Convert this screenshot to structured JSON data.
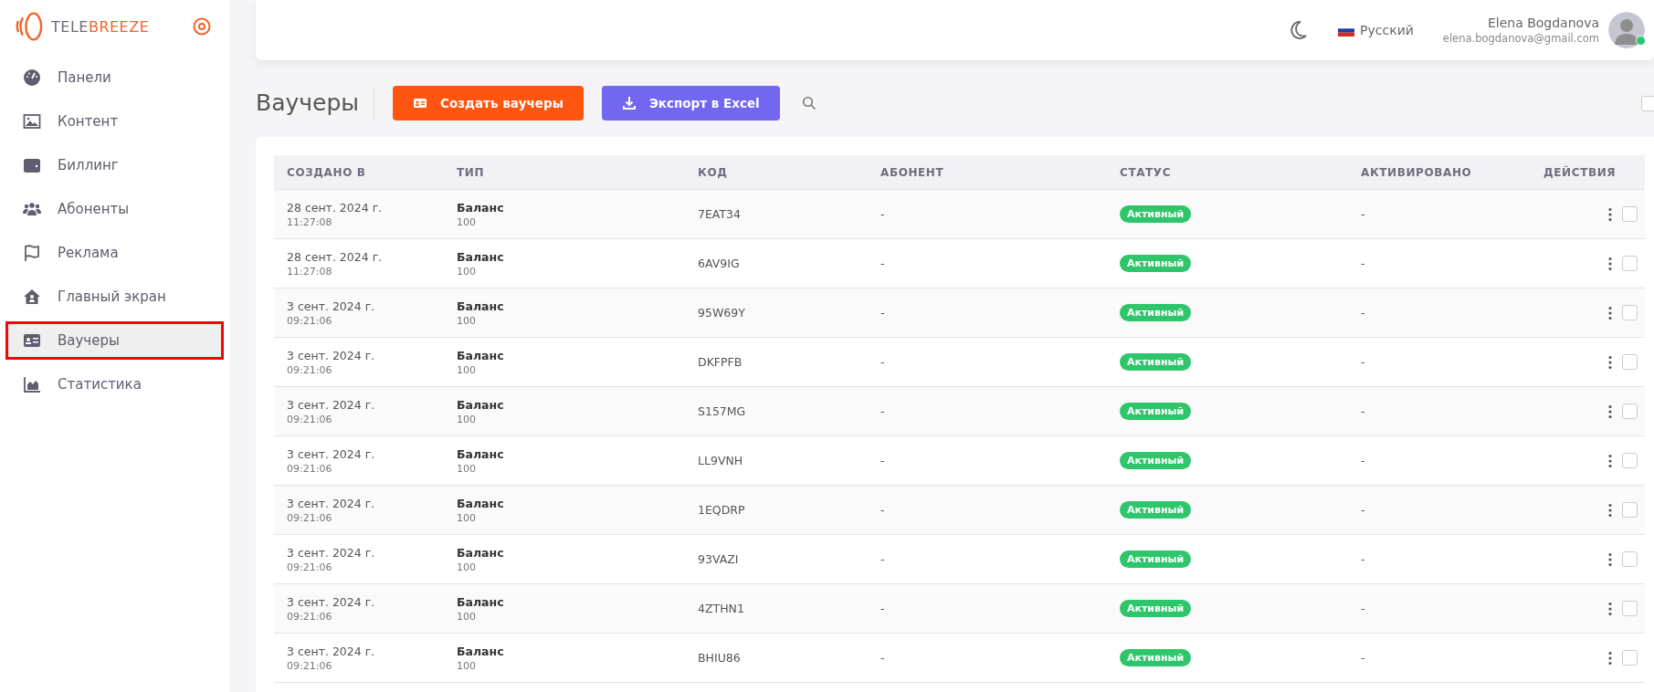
{
  "logo": {
    "text_main": "TELE",
    "text_accent": "BREEZE"
  },
  "sidebar": {
    "items": [
      {
        "label": "Панели",
        "kind": "gauge",
        "selected": false
      },
      {
        "label": "Контент",
        "kind": "image",
        "selected": false
      },
      {
        "label": "Биллинг",
        "kind": "wallet",
        "selected": false
      },
      {
        "label": "Абоненты",
        "kind": "users",
        "selected": false
      },
      {
        "label": "Реклама",
        "kind": "flag",
        "selected": false
      },
      {
        "label": "Главный экран",
        "kind": "home",
        "selected": false
      },
      {
        "label": "Ваучеры",
        "kind": "card",
        "selected": true
      },
      {
        "label": "Статистика",
        "kind": "chart",
        "selected": false
      }
    ]
  },
  "header": {
    "language": "Русский",
    "user_name": "Elena Bogdanova",
    "user_email": "elena.bogdanova@gmail.com",
    "online": true
  },
  "page": {
    "title": "Ваучеры",
    "create_button": "Создать ваучеры",
    "export_button": "Экспорт в Excel",
    "select_all_checked": false
  },
  "table": {
    "columns": [
      "СОЗДАНО В",
      "ТИП",
      "КОД",
      "АБОНЕНТ",
      "СТАТУС",
      "АКТИВИРОВАНО",
      "ДЕЙСТВИЯ"
    ],
    "rows": [
      {
        "date": "28 сент. 2024 г.",
        "time": "11:27:08",
        "type": "Баланс",
        "amount": "100",
        "code": "7EAT34",
        "subscriber": "-",
        "status": "Активный",
        "color": "#2ec56b",
        "activated": "-",
        "checked": false
      },
      {
        "date": "28 сент. 2024 г.",
        "time": "11:27:08",
        "type": "Баланс",
        "amount": "100",
        "code": "6AV9IG",
        "subscriber": "-",
        "status": "Активный",
        "color": "#2ec56b",
        "activated": "-",
        "checked": false
      },
      {
        "date": "3 сент. 2024 г.",
        "time": "09:21:06",
        "type": "Баланс",
        "amount": "100",
        "code": "95W69Y",
        "subscriber": "-",
        "status": "Активный",
        "color": "#2ec56b",
        "activated": "-",
        "checked": false
      },
      {
        "date": "3 сент. 2024 г.",
        "time": "09:21:06",
        "type": "Баланс",
        "amount": "100",
        "code": "DKFPFB",
        "subscriber": "-",
        "status": "Активный",
        "color": "#2ec56b",
        "activated": "-",
        "checked": false
      },
      {
        "date": "3 сент. 2024 г.",
        "time": "09:21:06",
        "type": "Баланс",
        "amount": "100",
        "code": "S157MG",
        "subscriber": "-",
        "status": "Активный",
        "color": "#2ec56b",
        "activated": "-",
        "checked": false
      },
      {
        "date": "3 сент. 2024 г.",
        "time": "09:21:06",
        "type": "Баланс",
        "amount": "100",
        "code": "LL9VNH",
        "subscriber": "-",
        "status": "Активный",
        "color": "#2ec56b",
        "activated": "-",
        "checked": false
      },
      {
        "date": "3 сент. 2024 г.",
        "time": "09:21:06",
        "type": "Баланс",
        "amount": "100",
        "code": "1EQDRP",
        "subscriber": "-",
        "status": "Активный",
        "color": "#2ec56b",
        "activated": "-",
        "checked": false
      },
      {
        "date": "3 сент. 2024 г.",
        "time": "09:21:06",
        "type": "Баланс",
        "amount": "100",
        "code": "93VAZI",
        "subscriber": "-",
        "status": "Активный",
        "color": "#2ec56b",
        "activated": "-",
        "checked": false
      },
      {
        "date": "3 сент. 2024 г.",
        "time": "09:21:06",
        "type": "Баланс",
        "amount": "100",
        "code": "4ZTHN1",
        "subscriber": "-",
        "status": "Активный",
        "color": "#2ec56b",
        "activated": "-",
        "checked": false
      },
      {
        "date": "3 сент. 2024 г.",
        "time": "09:21:06",
        "type": "Баланс",
        "amount": "100",
        "code": "BHIU86",
        "subscriber": "-",
        "status": "Активный",
        "color": "#2ec56b",
        "activated": "-",
        "checked": false
      }
    ]
  }
}
